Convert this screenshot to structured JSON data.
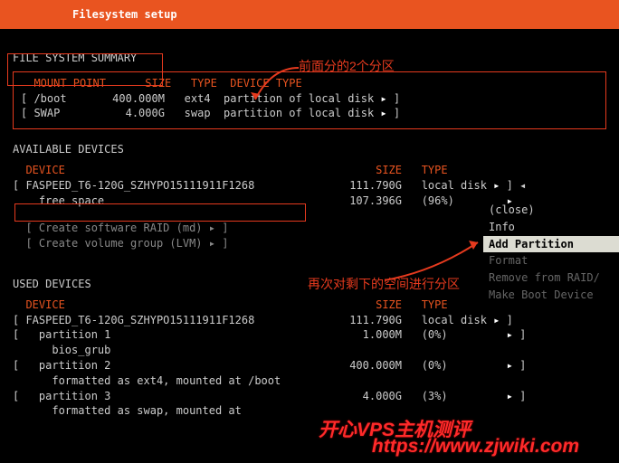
{
  "header": {
    "title": "Filesystem setup"
  },
  "annotations": {
    "top": "前面分的2个分区",
    "mid": "再次对剩下的空间进行分区"
  },
  "fs_summary": {
    "title": "FILE SYSTEM SUMMARY",
    "cols": {
      "mount": "MOUNT POINT",
      "size": "SIZE",
      "type": "TYPE",
      "devtype": "DEVICE TYPE"
    },
    "rows": [
      {
        "mount": "/boot",
        "size": "400.000M",
        "type": "ext4",
        "devtype": "partition of local disk"
      },
      {
        "mount": "SWAP",
        "size": "4.000G",
        "type": "swap",
        "devtype": "partition of local disk"
      }
    ]
  },
  "available": {
    "title": "AVAILABLE DEVICES",
    "cols": {
      "device": "DEVICE",
      "size": "SIZE",
      "type": "TYPE"
    },
    "device": {
      "name": "FASPEED_T6-120G_SZHYPO15111911F1268",
      "size": "111.790G",
      "type": "local disk"
    },
    "free": {
      "label": "free space",
      "size": "107.396G",
      "pct": "(96%)"
    },
    "actions": {
      "raid": "Create software RAID (md)",
      "lvm": "Create volume group (LVM)"
    }
  },
  "context_menu": {
    "close": "(close)",
    "info": "Info",
    "add_partition": "Add Partition",
    "format": "Format",
    "remove": "Remove from RAID/",
    "boot": "Make Boot Device"
  },
  "used": {
    "title": "USED DEVICES",
    "cols": {
      "device": "DEVICE",
      "size": "SIZE",
      "type": "TYPE"
    },
    "device": {
      "name": "FASPEED_T6-120G_SZHYPO15111911F1268",
      "size": "111.790G",
      "type": "local disk"
    },
    "parts": [
      {
        "name": "partition 1",
        "size": "1.000M",
        "pct": "(0%)",
        "sub": "bios_grub"
      },
      {
        "name": "partition 2",
        "size": "400.000M",
        "pct": "(0%)",
        "sub": "formatted as ext4, mounted at /boot"
      },
      {
        "name": "partition 3",
        "size": "4.000G",
        "pct": "(3%)",
        "sub": "formatted as swap, mounted at"
      }
    ]
  },
  "watermark": "https://www.zjwiki.com",
  "watermark_cn": "开心VPS主机测评"
}
